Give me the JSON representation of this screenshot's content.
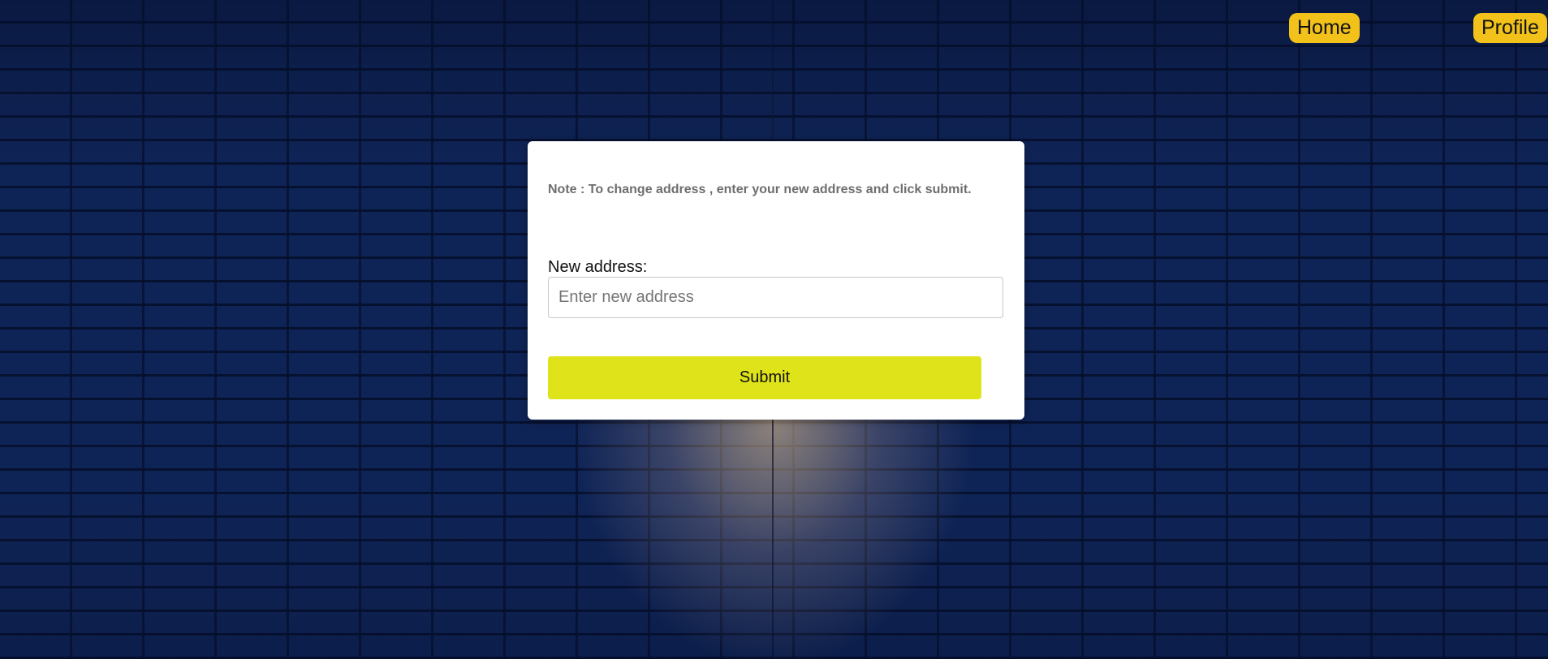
{
  "nav": {
    "home_label": "Home",
    "profile_label": "Profile"
  },
  "form": {
    "note": "Note : To change address , enter your new address and click submit.",
    "address_label": "New address:",
    "address_value": "",
    "address_placeholder": "Enter new address",
    "submit_label": "Submit"
  },
  "colors": {
    "nav_pill": "#f2c21b",
    "submit_button": "#dfe31a",
    "background": "#0f2456",
    "card": "#ffffff"
  }
}
